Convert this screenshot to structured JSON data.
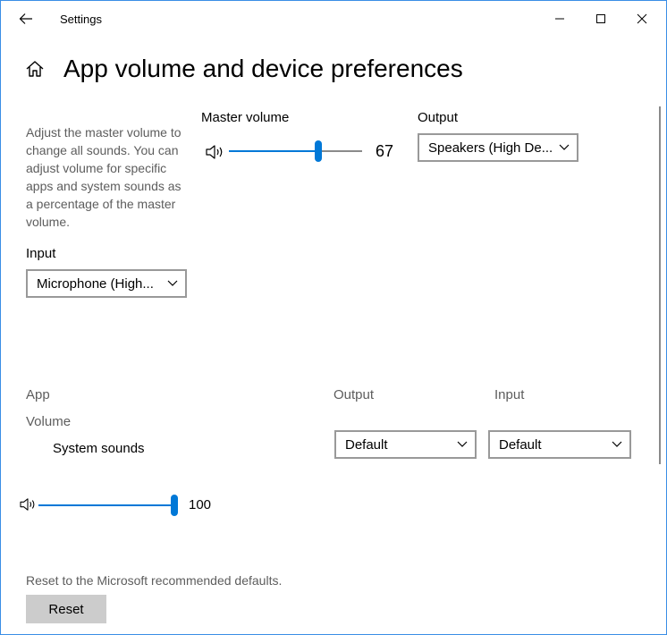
{
  "window": {
    "title": "Settings"
  },
  "page": {
    "title": "App volume and device preferences",
    "description": "Adjust the master volume to change all sounds. You can adjust volume for specific apps and system sounds as a percentage of the master volume."
  },
  "master": {
    "label": "Master volume",
    "value": 67,
    "value_text": "67",
    "output_label": "Output",
    "output_selected": "Speakers (High De...",
    "input_label": "Input",
    "input_selected": "Microphone (High..."
  },
  "apps_table": {
    "col_app": "App",
    "col_volume": "Volume",
    "col_output": "Output",
    "col_input": "Input",
    "rows": [
      {
        "name": "System sounds",
        "volume": 100,
        "volume_text": "100",
        "output": "Default",
        "input": "Default"
      }
    ]
  },
  "reset": {
    "description": "Reset to the Microsoft recommended defaults.",
    "button_label": "Reset"
  },
  "colors": {
    "accent": "#0078d7",
    "window_border": "#3a8ee6",
    "muted_text": "#5d5d5d",
    "button_bg": "#cccccc"
  },
  "icons": {
    "back": "back-arrow-icon",
    "home": "home-icon",
    "speaker": "speaker-icon",
    "chevron": "chevron-down-icon",
    "minimize": "minimize-icon",
    "maximize": "maximize-icon",
    "close": "close-icon"
  }
}
